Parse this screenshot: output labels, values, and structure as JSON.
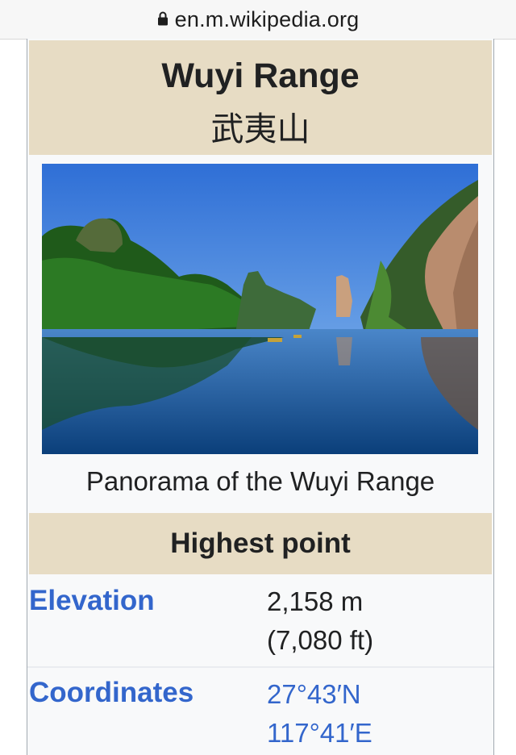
{
  "browser": {
    "url": "en.m.wikipedia.org",
    "lock_icon": "lock-icon"
  },
  "infobox": {
    "title": "Wuyi Range",
    "native_name": "武夷山",
    "image_caption": "Panorama of the Wuyi Range",
    "section_heading": "Highest point",
    "rows": [
      {
        "label": "Elevation",
        "value_line1": "2,158 m",
        "value_line2": "(7,080 ft)"
      },
      {
        "label": "Coordinates",
        "value_line1": "27°43′N",
        "value_line2": "117°41′E"
      }
    ]
  },
  "colors": {
    "header_background": "#e7dcc4",
    "infobox_background": "#f8f9fa",
    "link": "#3366cc",
    "text": "#202122"
  }
}
